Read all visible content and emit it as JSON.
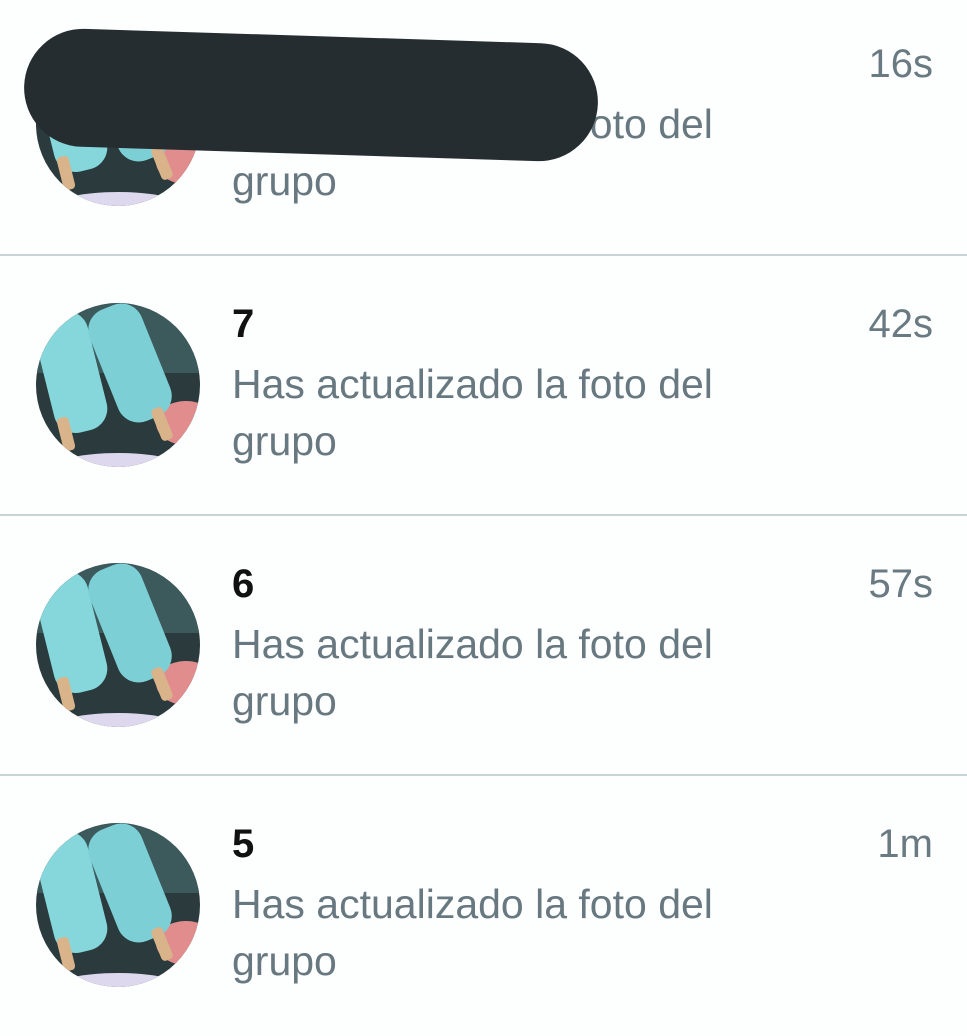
{
  "chats": [
    {
      "title": "",
      "message": "Has actualizado la foto del grupo",
      "time": "16s",
      "avatar": "popsicle-group-photo"
    },
    {
      "title": "7",
      "message": "Has actualizado la foto del grupo",
      "time": "42s",
      "avatar": "popsicle-group-photo"
    },
    {
      "title": "6",
      "message": "Has actualizado la foto del grupo",
      "time": "57s",
      "avatar": "popsicle-group-photo"
    },
    {
      "title": "5",
      "message": "Has actualizado la foto del grupo",
      "time": "1m",
      "avatar": "popsicle-group-photo"
    }
  ],
  "colors": {
    "background": "#fdfefe",
    "title": "#111111",
    "message": "#687880",
    "time": "#6a7a82",
    "divider": "#c9d4d7",
    "redaction": "#262d31"
  }
}
